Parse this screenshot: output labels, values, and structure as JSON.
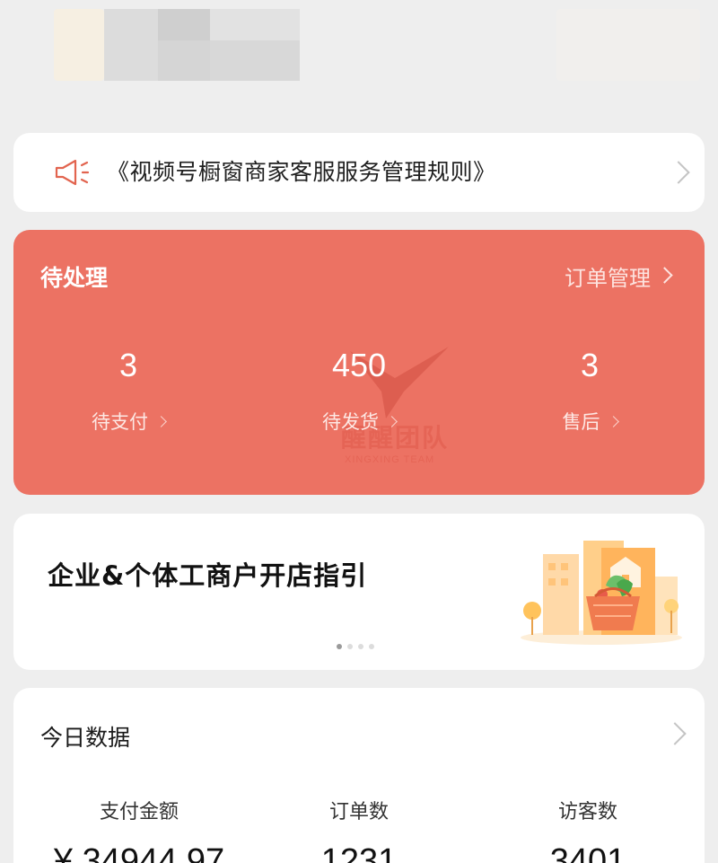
{
  "notice": {
    "text": "《视频号橱窗商家客服服务管理规则》",
    "icon": "speaker-icon"
  },
  "pending": {
    "title": "待处理",
    "manage_link": "订单管理",
    "accent": "#ec7263",
    "stats": [
      {
        "value": "3",
        "label": "待支付"
      },
      {
        "value": "450",
        "label": "待发货"
      },
      {
        "value": "3",
        "label": "售后"
      }
    ],
    "watermark_cn": "醒醒团队",
    "watermark_en": "XINGXING TEAM"
  },
  "guide": {
    "title": "企业&个体工商户开店指引",
    "dots": 4,
    "active_dot": 0
  },
  "today": {
    "title": "今日数据",
    "metrics": [
      {
        "label": "支付金额",
        "value": "¥ 34944.97"
      },
      {
        "label": "订单数",
        "value": "1231"
      },
      {
        "label": "访客数",
        "value": "3401"
      }
    ]
  }
}
